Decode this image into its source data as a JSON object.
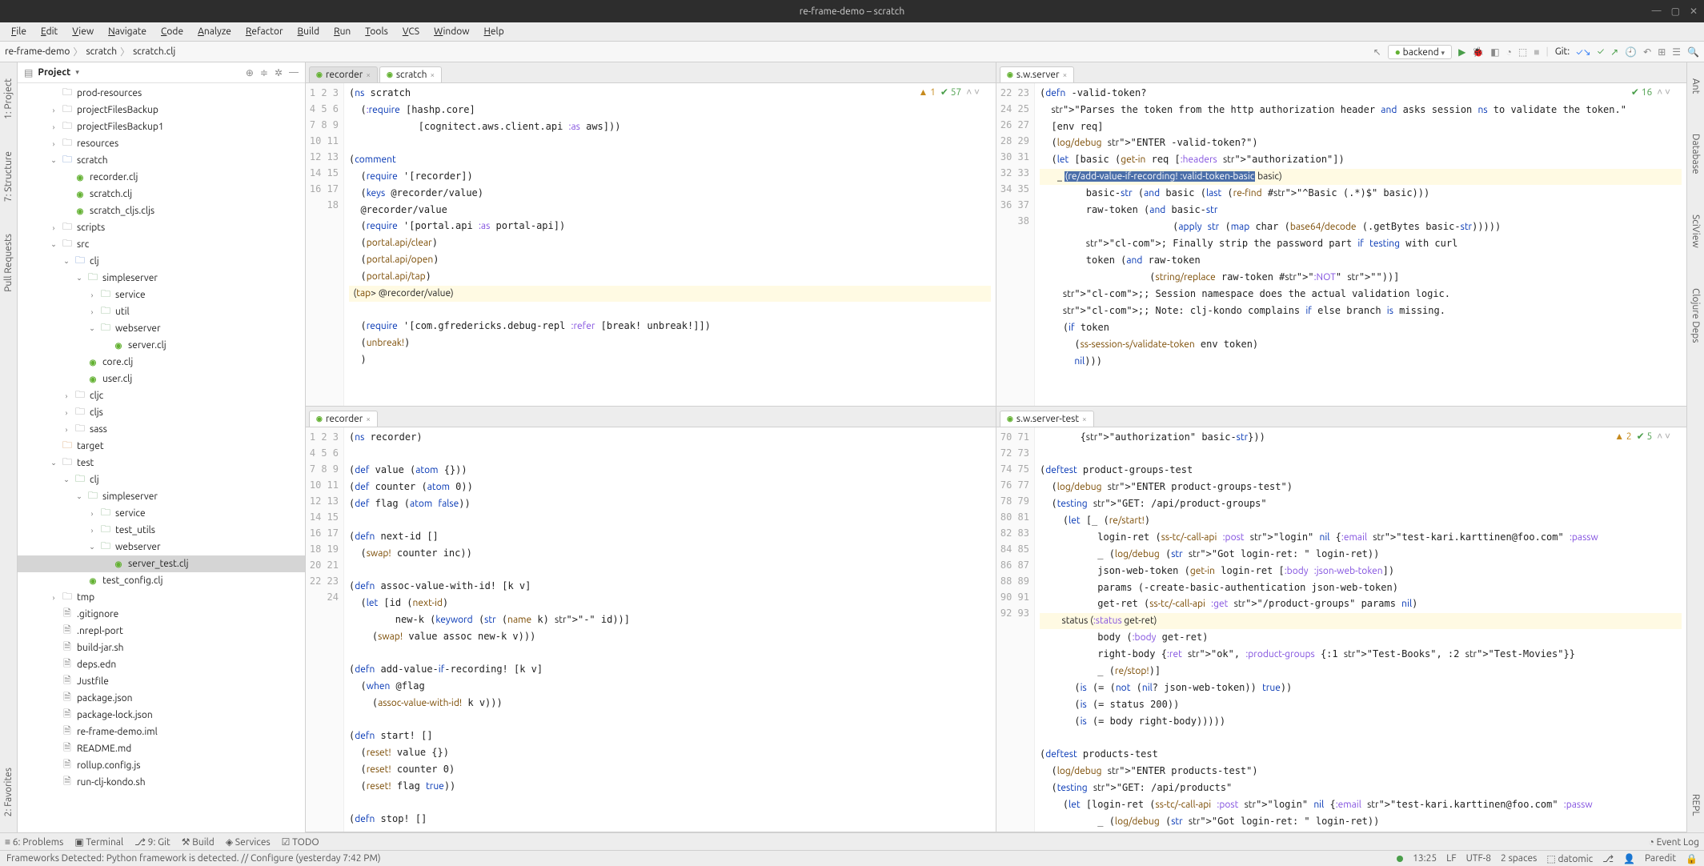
{
  "window": {
    "title": "re-frame-demo – scratch"
  },
  "menu": [
    "File",
    "Edit",
    "View",
    "Navigate",
    "Code",
    "Analyze",
    "Refactor",
    "Build",
    "Run",
    "Tools",
    "VCS",
    "Window",
    "Help"
  ],
  "breadcrumb": [
    "re-frame-demo",
    "scratch",
    "scratch.clj"
  ],
  "runconfig": "backend",
  "git_label": "Git:",
  "left_tool_tabs": [
    "1: Project",
    "7: Structure",
    "Pull Requests",
    "2: Favorites"
  ],
  "right_tool_tabs": [
    "Ant",
    "Database",
    "SciView",
    "Clojure Deps",
    "REPL"
  ],
  "project_panel_title": "Project",
  "tree": [
    {
      "d": 2,
      "a": "",
      "i": "folder",
      "t": "prod-resources"
    },
    {
      "d": 2,
      "a": "›",
      "i": "folder",
      "t": "projectFilesBackup"
    },
    {
      "d": 2,
      "a": "›",
      "i": "folder",
      "t": "projectFilesBackup1"
    },
    {
      "d": 2,
      "a": "›",
      "i": "folder",
      "t": "resources"
    },
    {
      "d": 2,
      "a": "⌄",
      "i": "folder-src",
      "t": "scratch"
    },
    {
      "d": 3,
      "a": "",
      "i": "clj",
      "t": "recorder.clj"
    },
    {
      "d": 3,
      "a": "",
      "i": "clj",
      "t": "scratch.clj"
    },
    {
      "d": 3,
      "a": "",
      "i": "clj",
      "t": "scratch_cljs.cljs"
    },
    {
      "d": 2,
      "a": "›",
      "i": "folder",
      "t": "scripts"
    },
    {
      "d": 2,
      "a": "⌄",
      "i": "folder",
      "t": "src"
    },
    {
      "d": 3,
      "a": "⌄",
      "i": "folder-src",
      "t": "clj"
    },
    {
      "d": 4,
      "a": "⌄",
      "i": "folder-pkg",
      "t": "simpleserver"
    },
    {
      "d": 5,
      "a": "›",
      "i": "folder-pkg",
      "t": "service"
    },
    {
      "d": 5,
      "a": "›",
      "i": "folder-pkg",
      "t": "util"
    },
    {
      "d": 5,
      "a": "⌄",
      "i": "folder-pkg",
      "t": "webserver"
    },
    {
      "d": 6,
      "a": "",
      "i": "clj",
      "t": "server.clj"
    },
    {
      "d": 4,
      "a": "",
      "i": "clj",
      "t": "core.clj"
    },
    {
      "d": 4,
      "a": "",
      "i": "clj",
      "t": "user.clj"
    },
    {
      "d": 3,
      "a": "›",
      "i": "folder",
      "t": "cljc"
    },
    {
      "d": 3,
      "a": "›",
      "i": "folder",
      "t": "cljs"
    },
    {
      "d": 3,
      "a": "›",
      "i": "folder",
      "t": "sass"
    },
    {
      "d": 2,
      "a": "",
      "i": "folder-target",
      "t": "target"
    },
    {
      "d": 2,
      "a": "⌄",
      "i": "folder",
      "t": "test"
    },
    {
      "d": 3,
      "a": "⌄",
      "i": "folder-test",
      "t": "clj"
    },
    {
      "d": 4,
      "a": "⌄",
      "i": "folder-pkg",
      "t": "simpleserver"
    },
    {
      "d": 5,
      "a": "›",
      "i": "folder-pkg",
      "t": "service"
    },
    {
      "d": 5,
      "a": "›",
      "i": "folder-pkg",
      "t": "test_utils"
    },
    {
      "d": 5,
      "a": "⌄",
      "i": "folder-pkg",
      "t": "webserver"
    },
    {
      "d": 6,
      "a": "",
      "i": "clj",
      "t": "server_test.clj",
      "sel": true
    },
    {
      "d": 4,
      "a": "",
      "i": "clj",
      "t": "test_config.clj"
    },
    {
      "d": 2,
      "a": "›",
      "i": "folder",
      "t": "tmp"
    },
    {
      "d": 2,
      "a": "",
      "i": "file",
      "t": ".gitignore"
    },
    {
      "d": 2,
      "a": "",
      "i": "file",
      "t": ".nrepl-port"
    },
    {
      "d": 2,
      "a": "",
      "i": "file",
      "t": "build-jar.sh"
    },
    {
      "d": 2,
      "a": "",
      "i": "file",
      "t": "deps.edn"
    },
    {
      "d": 2,
      "a": "",
      "i": "file",
      "t": "Justfile"
    },
    {
      "d": 2,
      "a": "",
      "i": "file",
      "t": "package.json"
    },
    {
      "d": 2,
      "a": "",
      "i": "file",
      "t": "package-lock.json"
    },
    {
      "d": 2,
      "a": "",
      "i": "file",
      "t": "re-frame-demo.iml"
    },
    {
      "d": 2,
      "a": "",
      "i": "file",
      "t": "README.md"
    },
    {
      "d": 2,
      "a": "",
      "i": "file",
      "t": "rollup.config.js"
    },
    {
      "d": 2,
      "a": "",
      "i": "file",
      "t": "run-clj-kondo.sh"
    }
  ],
  "editor_tl": {
    "tabs": [
      {
        "label": "recorder",
        "active": false
      },
      {
        "label": "scratch",
        "active": true
      }
    ],
    "indicators": {
      "warn": "1",
      "ok": "57"
    },
    "start": 1,
    "lines": [
      "(ns scratch",
      "  (:require [hashp.core]",
      "            [cognitect.aws.client.api :as aws]))",
      "",
      "(comment",
      "  (require '[recorder])",
      "  (keys @recorder/value)",
      "  @recorder/value",
      "  (require '[portal.api :as portal-api])",
      "  (portal.api/clear)",
      "  (portal.api/open)",
      "  (portal.api/tap)",
      "  (tap> @recorder/value)",
      "",
      "  (require '[com.gfredericks.debug-repl :refer [break! unbreak!]])",
      "  (unbreak!)",
      "  )",
      ""
    ],
    "highlight_idx": 12
  },
  "editor_tr": {
    "tabs": [
      {
        "label": "s.w.server",
        "active": true
      }
    ],
    "indicators": {
      "ok": "16"
    },
    "start": 22,
    "lines": [
      "(defn -valid-token?",
      "  \"Parses the token from the http authorization header and asks session ns to validate the token.\"",
      "  [env req]",
      "  (log/debug \"ENTER -valid-token?\")",
      "  (let [basic (get-in req [:headers \"authorization\"])",
      "        _ (re/add-value-if-recording! :valid-token-basic basic)",
      "        basic-str (and basic (last (re-find #\"^Basic (.*)$\" basic)))",
      "        raw-token (and basic-str",
      "                       (apply str (map char (base64/decode (.getBytes basic-str)))))",
      "        ; Finally strip the password part if testing with curl",
      "        token (and raw-token",
      "                   (string/replace raw-token #\":NOT\" \"\"))]",
      "    ;; Session namespace does the actual validation logic.",
      "    ;; Note: clj-kondo complains if else branch is missing.",
      "    (if token",
      "      (ss-session-s/validate-token env token)",
      "      nil)))"
    ],
    "highlight_idx": 5,
    "sel_text": "(re/add-value-if-recording! :valid-token-basic"
  },
  "editor_bl": {
    "tabs": [
      {
        "label": "recorder",
        "active": true
      }
    ],
    "start": 1,
    "lines": [
      "(ns recorder)",
      "",
      "(def value (atom {}))",
      "(def counter (atom 0))",
      "(def flag (atom false))",
      "",
      "(defn next-id []",
      "  (swap! counter inc))",
      "",
      "(defn assoc-value-with-id! [k v]",
      "  (let [id (next-id)",
      "        new-k (keyword (str (name k) \"-\" id))]",
      "    (swap! value assoc new-k v)))",
      "",
      "(defn add-value-if-recording! [k v]",
      "  (when @flag",
      "    (assoc-value-with-id! k v)))",
      "",
      "(defn start! []",
      "  (reset! value {})",
      "  (reset! counter 0)",
      "  (reset! flag true))",
      "",
      "(defn stop! []"
    ]
  },
  "editor_br": {
    "tabs": [
      {
        "label": "s.w.server-test",
        "active": true
      }
    ],
    "indicators": {
      "warn": "2",
      "ok": "5"
    },
    "start": 70,
    "lines": [
      "       {\"authorization\" basic-str}))",
      "",
      "(deftest product-groups-test",
      "  (log/debug \"ENTER product-groups-test\")",
      "  (testing \"GET: /api/product-groups\"",
      "    (let [_ (re/start!)",
      "          login-ret (ss-tc/-call-api :post \"login\" nil {:email \"test-kari.karttinen@foo.com\" :passw",
      "          _ (log/debug (str \"Got login-ret: \" login-ret))",
      "          json-web-token (get-in login-ret [:body :json-web-token])",
      "          params (-create-basic-authentication json-web-token)",
      "          get-ret (ss-tc/-call-api :get \"/product-groups\" params nil)",
      "          status (:status get-ret)",
      "          body (:body get-ret)",
      "          right-body {:ret \"ok\", :product-groups {:1 \"Test-Books\", :2 \"Test-Movies\"}}",
      "          _ (re/stop!)]",
      "      (is (= (not (nil? json-web-token)) true))",
      "      (is (= status 200))",
      "      (is (= body right-body)))))",
      "",
      "(deftest products-test",
      "  (log/debug \"ENTER products-test\")",
      "  (testing \"GET: /api/products\"",
      "    (let [login-ret (ss-tc/-call-api :post \"login\" nil {:email \"test-kari.karttinen@foo.com\" :passw",
      "          _ (log/debug (str \"Got login-ret: \" login-ret))"
    ],
    "highlight_idx": 11
  },
  "bottom_tools": [
    "≡ 6: Problems",
    "▣ Terminal",
    "⎇ 9: Git",
    "⚒ Build",
    "◈ Services",
    "☑ TODO"
  ],
  "bottom_right": "Event Log",
  "status": {
    "msg": "Frameworks Detected: Python framework is detected. // Configure (yesterday 7:42 PM)",
    "time": "13:25",
    "sep": "LF",
    "enc": "UTF-8",
    "indent": "2 spaces",
    "db": "datomic",
    "paredit": "Paredit"
  }
}
